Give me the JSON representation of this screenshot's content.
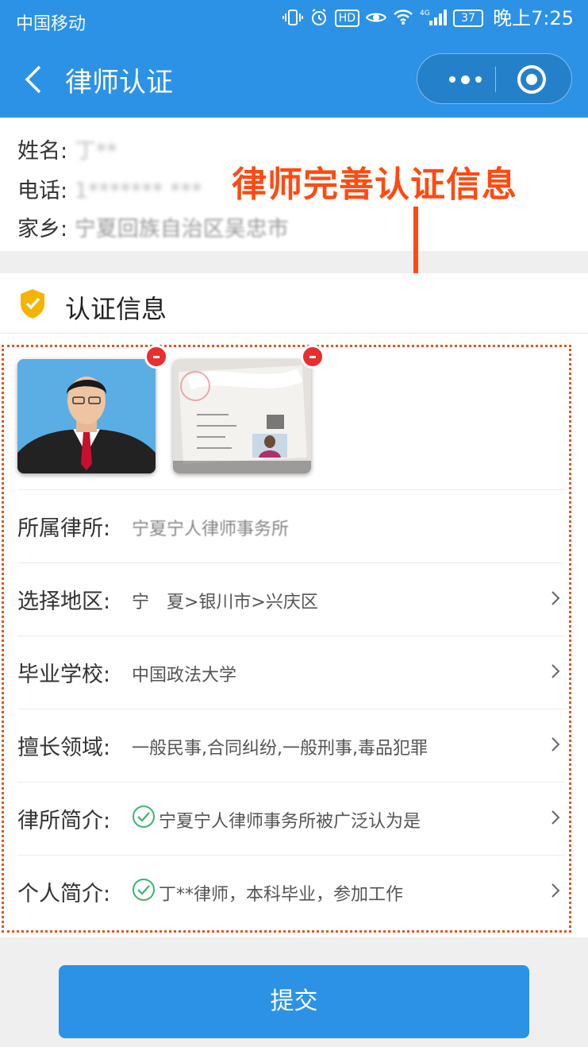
{
  "status_bar": {
    "carrier": "中国移动",
    "hd": "HD",
    "network": "4G",
    "battery": "37",
    "time": "晚上7:25"
  },
  "header": {
    "title": "律师认证",
    "back_icon": "chevron-left-icon",
    "more_icon": "more-dots-icon",
    "close_icon": "target-close-icon"
  },
  "basic_info": {
    "name_label": "姓名:",
    "name_value": "丁**",
    "phone_label": "电话:",
    "phone_value": "1******* ***",
    "home_label": "家乡:",
    "home_value": "宁夏回族自治区吴忠市"
  },
  "annotation": "律师完善认证信息",
  "cert": {
    "title": "认证信息",
    "shield_icon": "shield-check-icon",
    "photos": [
      "lawyer-portrait",
      "license-photo"
    ],
    "fields": [
      {
        "label": "所属律所:",
        "value": "宁夏宁人律师事务所",
        "check": false,
        "chevron": false
      },
      {
        "label": "选择地区:",
        "value": "宁　夏>银川市>兴庆区",
        "check": false,
        "chevron": true
      },
      {
        "label": "毕业学校:",
        "value": "中国政法大学",
        "check": false,
        "chevron": true
      },
      {
        "label": "擅长领域:",
        "value": "一般民事,合同纠纷,一般刑事,毒品犯罪",
        "check": false,
        "chevron": true
      },
      {
        "label": "律所简介:",
        "value": "宁夏宁人律师事务所被广泛认为是",
        "check": true,
        "chevron": true
      },
      {
        "label": "个人简介:",
        "value": "丁**律师，本科毕业，参加工作",
        "check": true,
        "chevron": true
      }
    ]
  },
  "submit_label": "提交",
  "colors": {
    "brand": "#2b92e6",
    "annotation": "#ff4a12",
    "check": "#3cb371",
    "badge": "#e82e2e",
    "shield": "#f5b400"
  }
}
